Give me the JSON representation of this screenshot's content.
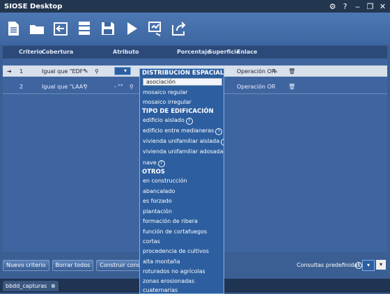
{
  "window": {
    "title": "SIOSE Desktop",
    "controls": [
      "⚙",
      "?",
      "‒",
      "❐",
      "✕"
    ]
  },
  "toolbar": {
    "icons": [
      "new-document-icon",
      "open-folder-icon",
      "import-icon",
      "database-icon",
      "save-icon",
      "run-icon",
      "query-icon",
      "export-icon"
    ]
  },
  "table": {
    "headers": {
      "criterio": "Criterio",
      "cobertura": "Cobertura",
      "atributo": "Atributo",
      "porcentaje": "Porcentaje",
      "superficie": "Superficie",
      "enlace": "Enlace"
    },
    "rows": [
      {
        "num": "1",
        "cobertura": "Igual que  \"EDF\"",
        "atributo": "",
        "enlace": "Operación OR"
      },
      {
        "num": "2",
        "cobertura": "Igual que \"LAA\"",
        "atributo": "- \"\"",
        "enlace": "Operación OR"
      }
    ]
  },
  "dropdown": {
    "sections": [
      {
        "title": "DISTRIBUCIÓN ESPACIAL",
        "items": [
          "asociación",
          "mosaico regular",
          "mosaico irregular"
        ],
        "selected": 0
      },
      {
        "title": "TIPO DE EDIFICACIÓN",
        "items": [
          "edificio aislado",
          "edificio entre medianeras",
          "vivienda unifamiliar aislada",
          "vivienda unifamiliar adosada",
          "nave"
        ]
      },
      {
        "title": "OTROS",
        "items": [
          "en construcción",
          "abancalado",
          "es forzado",
          "plantación",
          "formación de ribera",
          "función de cortafuegos",
          "cortas",
          "procedencia de cultivos",
          "alta montaña",
          "roturados no agrícolas",
          "zonas erosionadas",
          "cuaternarias"
        ]
      }
    ]
  },
  "buttons": {
    "nuevo": "Nuevo criterio",
    "borrar": "Borrar todos",
    "construir": "Construir consulta"
  },
  "consultas": {
    "label": "Consultas predefinidas:"
  },
  "tab": {
    "label": "bbdd_capturas"
  }
}
